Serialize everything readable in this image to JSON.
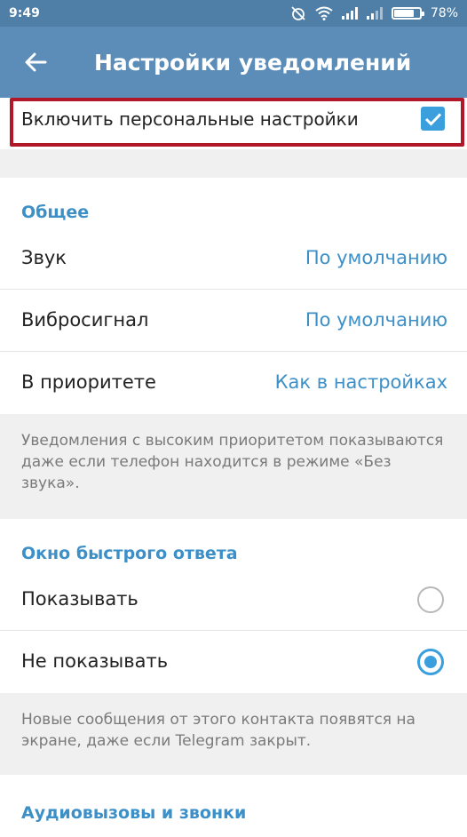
{
  "status_bar": {
    "time": "9:49",
    "battery": "78%"
  },
  "header": {
    "title": "Настройки уведомлений"
  },
  "personal": {
    "label": "Включить персональные настройки",
    "checked": true
  },
  "general": {
    "title": "Общее",
    "rows": [
      {
        "label": "Звук",
        "value": "По умолчанию"
      },
      {
        "label": "Вибросигнал",
        "value": "По умолчанию"
      },
      {
        "label": "В приоритете",
        "value": "Как в настройках"
      }
    ],
    "note": "Уведомления с высоким приоритетом показываются даже если телефон находится в режиме «Без звука»."
  },
  "quick_reply": {
    "title": "Окно быстрого ответа",
    "options": [
      {
        "label": "Показывать",
        "selected": false
      },
      {
        "label": "Не показывать",
        "selected": true
      }
    ],
    "note": "Новые сообщения от этого контакта появятся на экране, даже если Telegram закрыт."
  },
  "calls": {
    "title": "Аудиовызовы и звонки"
  },
  "colors": {
    "accent": "#3c8fc7",
    "appbar": "#5b8db8",
    "highlight": "#b0182a"
  }
}
